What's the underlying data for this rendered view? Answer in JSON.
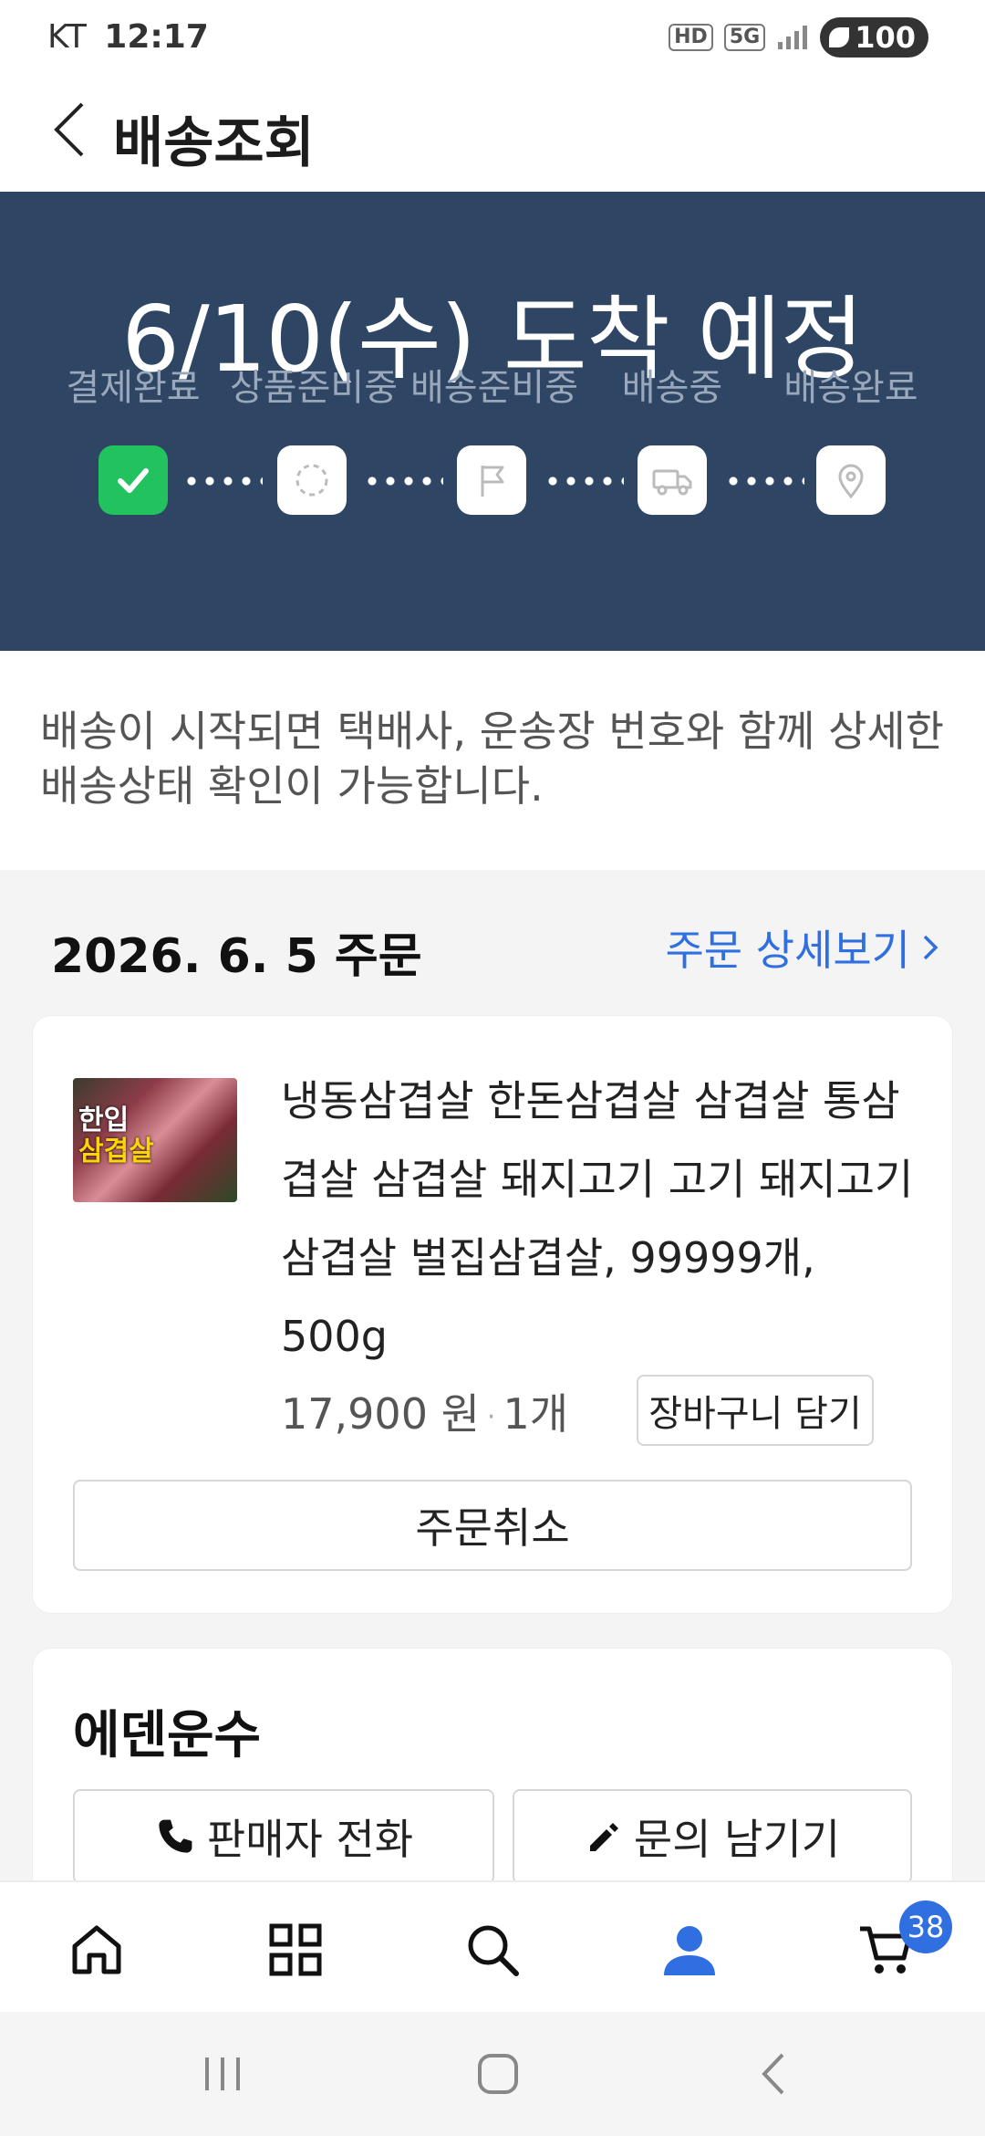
{
  "status_bar": {
    "carrier": "KT",
    "time": "12:17",
    "hd": "HD",
    "network": "5G",
    "battery": "100"
  },
  "header": {
    "title": "배송조회"
  },
  "hero": {
    "arrival_text": "6/10(수) 도착 예정",
    "steps": [
      {
        "label": "결제완료",
        "icon": "check-icon",
        "done": true
      },
      {
        "label": "상품준비중",
        "icon": "loading-icon",
        "done": false
      },
      {
        "label": "배송준비중",
        "icon": "flag-icon",
        "done": false
      },
      {
        "label": "배송중",
        "icon": "truck-icon",
        "done": false
      },
      {
        "label": "배송완료",
        "icon": "location-pin-icon",
        "done": false
      }
    ]
  },
  "info": {
    "message": "배송이 시작되면 택배사, 운송장 번호와 함께 상세한 배송상태 확인이 가능합니다."
  },
  "order": {
    "date_label": "2026. 6. 5 주문",
    "detail_link": "주문 상세보기"
  },
  "product": {
    "thumb_line1": "한입",
    "thumb_line2": "삼겹살",
    "name": "냉동삼겹살 한돈삼겹살 삼겹살 통삼겹살 삼겹살 돼지고기 고기 돼지고기삼겹살 벌집삼겹살, 99999개, 500g",
    "price": "17,900 원",
    "separator": "·",
    "quantity": "1개",
    "add_to_cart": "장바구니 담기",
    "cancel_order": "주문취소"
  },
  "seller": {
    "name": "에덴운수",
    "call_label": "판매자 전화",
    "inquiry_label": "문의 남기기"
  },
  "bottom_nav": {
    "items": [
      "home-icon",
      "category-grid-icon",
      "search-icon",
      "my-page-person-icon",
      "cart-icon"
    ],
    "cart_count": "38",
    "active_color": "#2f6fe0"
  },
  "colors": {
    "hero_bg": "#2e4564",
    "step_done": "#22c35e",
    "link": "#2f6fe0"
  }
}
